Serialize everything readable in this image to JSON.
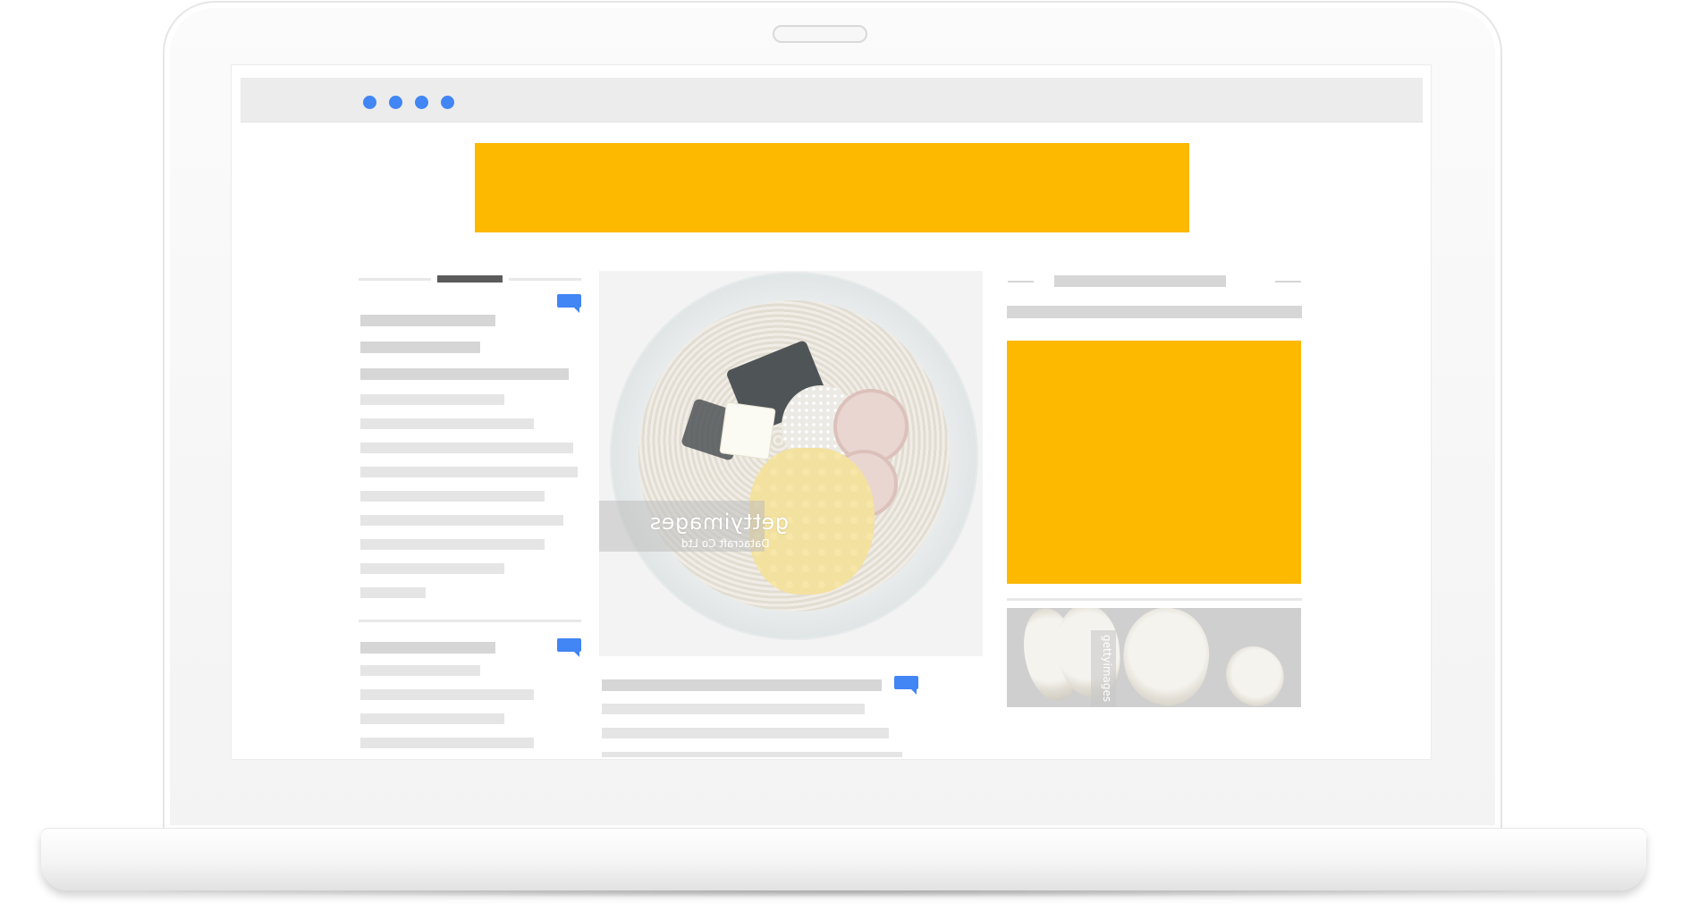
{
  "colors": {
    "accent_blue": "#4285f4",
    "ad_yellow": "#fdb900",
    "placeholder_gray": "#d6d6d6"
  },
  "browser": {
    "window_dots": [
      "dot",
      "dot",
      "dot",
      "dot"
    ]
  },
  "main_image": {
    "watermark_brand": "gettyimages",
    "watermark_credit": "Datacraft Co Ltd"
  },
  "side_image": {
    "watermark_brand": "gettyimages"
  },
  "icons": {
    "comment": "comment-bubble-icon"
  }
}
